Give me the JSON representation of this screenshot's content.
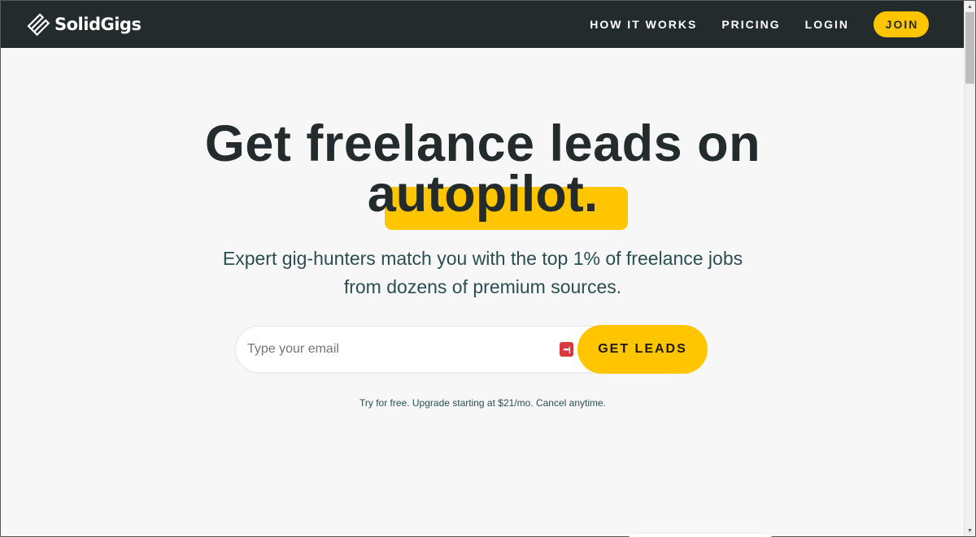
{
  "brand": {
    "name": "SolidGigs",
    "logo_icon": "zigzag-diamond-logo-icon"
  },
  "nav": {
    "links": [
      {
        "label": "HOW IT WORKS"
      },
      {
        "label": "PRICING"
      },
      {
        "label": "LOGIN"
      }
    ],
    "join_label": "JOIN"
  },
  "hero": {
    "headline_line1": "Get freelance leads on",
    "headline_highlight": "autopilot.",
    "subtitle_line1": "Expert gig-hunters match you with the top 1% of freelance jobs",
    "subtitle_line2": "from dozens of premium sources.",
    "email_placeholder": "Type your email",
    "email_value": "",
    "password_manager_icon": "password-manager-icon",
    "cta_label": "GET LEADS",
    "fine_print": "Try for free. Upgrade starting at $21/mo. Cancel anytime."
  },
  "colors": {
    "nav_bg": "#232b2c",
    "accent": "#ffc600",
    "text_dark": "#232b2c",
    "text_teal": "#2a4e51",
    "page_bg": "#f7f7f7"
  }
}
